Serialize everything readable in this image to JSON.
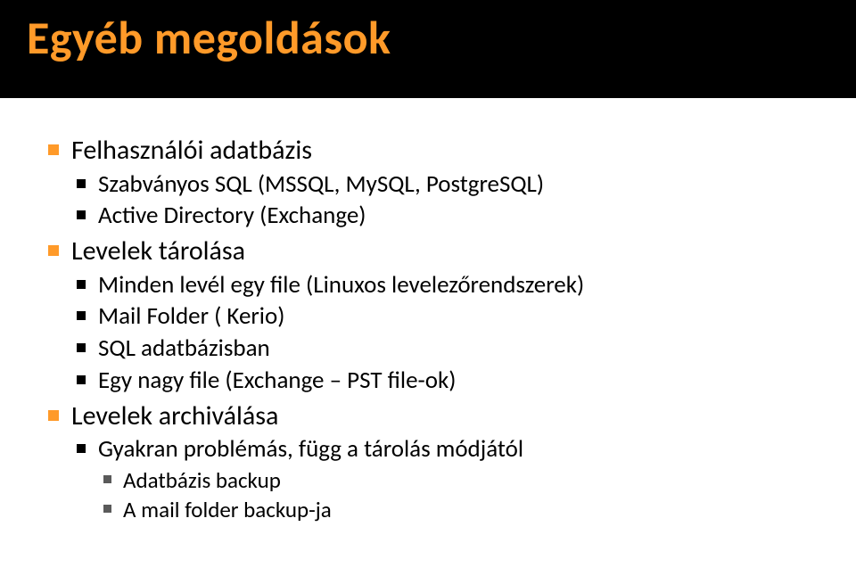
{
  "header": {
    "title": "Egyéb megoldások"
  },
  "content": {
    "items": [
      {
        "label": "Felhasználói adatbázis",
        "children": [
          {
            "label": "Szabványos SQL (MSSQL, MySQL, PostgreSQL)"
          },
          {
            "label": "Active Directory (Exchange)"
          }
        ]
      },
      {
        "label": "Levelek tárolása",
        "children": [
          {
            "label": "Minden levél egy file (Linuxos levelezőrendszerek)"
          },
          {
            "label": "Mail Folder ( Kerio)"
          },
          {
            "label": "SQL adatbázisban"
          },
          {
            "label": "Egy nagy file (Exchange – PST file-ok)"
          }
        ]
      },
      {
        "label": "Levelek archiválása",
        "children": [
          {
            "label": "Gyakran problémás, függ a tárolás módjától",
            "children": [
              {
                "label": "Adatbázis backup"
              },
              {
                "label": "A mail folder backup-ja"
              }
            ]
          }
        ]
      }
    ]
  }
}
